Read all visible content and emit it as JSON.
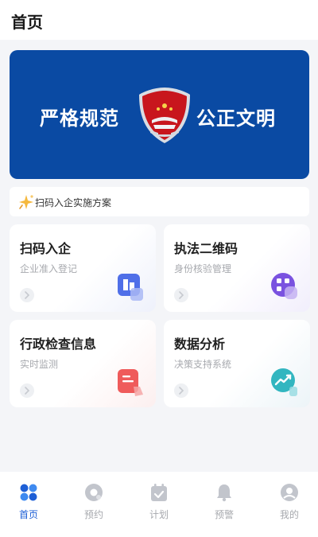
{
  "header": {
    "title": "首页"
  },
  "banner": {
    "slogan_left": "严格规范",
    "slogan_right": "公正文明",
    "emblem_icon": "procuratorate-emblem-icon",
    "color": "#0a4aa3"
  },
  "notice": {
    "icon": "sparkle-icon",
    "text": "扫码入企实施方案"
  },
  "cards": [
    {
      "title": "扫码入企",
      "subtitle": "企业准入登记",
      "icon": "building-icon",
      "accent": "#4f6fe8"
    },
    {
      "title": "执法二维码",
      "subtitle": "身份核验管理",
      "icon": "qrcode-icon",
      "accent": "#7a52e0"
    },
    {
      "title": "行政检查信息",
      "subtitle": "实时监测",
      "icon": "document-icon",
      "accent": "#ef5b5b"
    },
    {
      "title": "数据分析",
      "subtitle": "决策支持系统",
      "icon": "trend-chart-icon",
      "accent": "#32b6c0"
    }
  ],
  "tabbar": {
    "active_color": "#1e5fd6",
    "inactive_color": "#c2c5cc",
    "items": [
      {
        "label": "首页",
        "icon": "home-grid-icon",
        "active": true
      },
      {
        "label": "预约",
        "icon": "appointment-icon",
        "active": false
      },
      {
        "label": "计划",
        "icon": "calendar-check-icon",
        "active": false
      },
      {
        "label": "预警",
        "icon": "bell-icon",
        "active": false
      },
      {
        "label": "我的",
        "icon": "user-icon",
        "active": false
      }
    ]
  }
}
